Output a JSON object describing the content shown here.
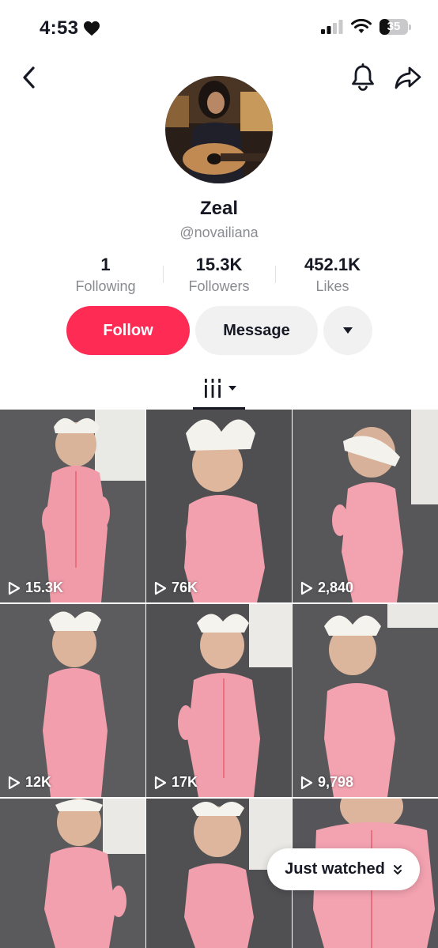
{
  "status_bar": {
    "time": "4:53",
    "battery_level": "35"
  },
  "profile": {
    "display_name": "Zeal",
    "username": "@novailiana"
  },
  "stats": [
    {
      "value": "1",
      "label": "Following"
    },
    {
      "value": "15.3K",
      "label": "Followers"
    },
    {
      "value": "452.1K",
      "label": "Likes"
    }
  ],
  "actions": {
    "follow_label": "Follow",
    "message_label": "Message"
  },
  "videos": [
    {
      "views": "15.3K"
    },
    {
      "views": "76K"
    },
    {
      "views": "2,840"
    },
    {
      "views": "12K"
    },
    {
      "views": "17K"
    },
    {
      "views": "9,798"
    },
    {
      "views": ""
    },
    {
      "views": ""
    },
    {
      "views": ""
    }
  ],
  "floating": {
    "just_watched_label": "Just watched"
  },
  "colors": {
    "accent": "#fe2c55",
    "secondary_button": "#f1f1f2",
    "muted_text": "#8a8b91"
  },
  "icons": [
    "back-icon",
    "bell-icon",
    "share-icon",
    "heart-icon",
    "cellular-icon",
    "wifi-icon",
    "battery-icon",
    "grid-icon",
    "play-icon",
    "chevrons-down-icon"
  ]
}
